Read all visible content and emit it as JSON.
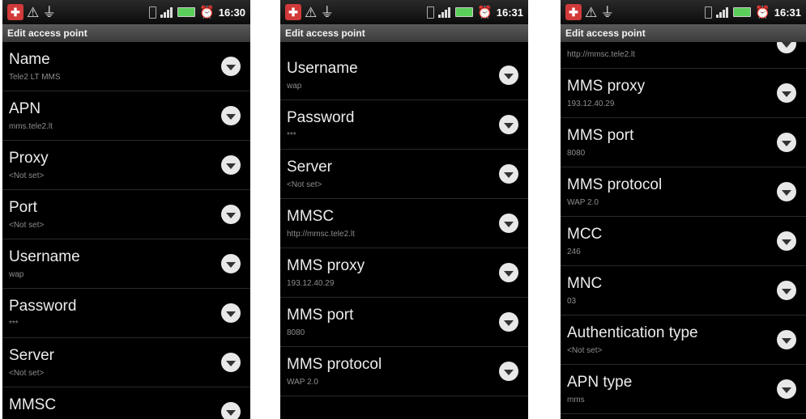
{
  "screens": [
    {
      "time": "16:30",
      "title": "Edit access point",
      "rows": [
        {
          "label": "Name",
          "value": "Tele2 LT MMS"
        },
        {
          "label": "APN",
          "value": "mms.tele2.lt"
        },
        {
          "label": "Proxy",
          "value": "<Not set>"
        },
        {
          "label": "Port",
          "value": "<Not set>"
        },
        {
          "label": "Username",
          "value": "wap"
        },
        {
          "label": "Password",
          "value": "***"
        },
        {
          "label": "Server",
          "value": "<Not set>"
        },
        {
          "label": "MMSC",
          "value": ""
        }
      ]
    },
    {
      "time": "16:31",
      "title": "Edit access point",
      "rows": [
        {
          "label": "Username",
          "value": "wap"
        },
        {
          "label": "Password",
          "value": "***"
        },
        {
          "label": "Server",
          "value": "<Not set>"
        },
        {
          "label": "MMSC",
          "value": "http://mmsc.tele2.lt"
        },
        {
          "label": "MMS proxy",
          "value": "193.12.40.29"
        },
        {
          "label": "MMS port",
          "value": "8080"
        },
        {
          "label": "MMS protocol",
          "value": "WAP 2.0"
        }
      ]
    },
    {
      "time": "16:31",
      "title": "Edit access point",
      "rows": [
        {
          "label": "",
          "value": "http://mmsc.tele2.lt"
        },
        {
          "label": "MMS proxy",
          "value": "193.12.40.29"
        },
        {
          "label": "MMS port",
          "value": "8080"
        },
        {
          "label": "MMS protocol",
          "value": "WAP 2.0"
        },
        {
          "label": "MCC",
          "value": "246"
        },
        {
          "label": "MNC",
          "value": "03"
        },
        {
          "label": "Authentication type",
          "value": "<Not set>"
        },
        {
          "label": "APN type",
          "value": "mms"
        }
      ]
    }
  ]
}
